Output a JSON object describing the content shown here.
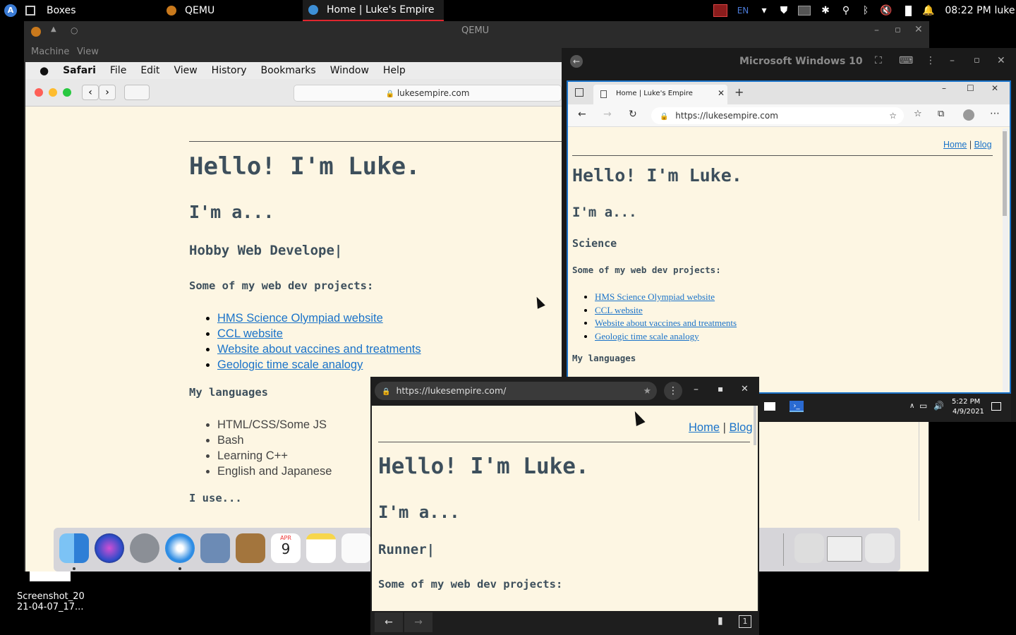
{
  "topbar": {
    "tasks": [
      {
        "label": "Boxes",
        "icon": "boxes-icon"
      },
      {
        "label": "QEMU",
        "icon": "qemu-icon"
      },
      {
        "label": "Home | Luke's Empire",
        "icon": "globe-icon"
      }
    ],
    "lang": "EN",
    "clock": "08:22 PM",
    "user": "luke"
  },
  "qemu": {
    "title": "QEMU",
    "menu": [
      "Machine",
      "View"
    ]
  },
  "mac": {
    "menubar": [
      "Safari",
      "File",
      "Edit",
      "View",
      "History",
      "Bookmarks",
      "Window",
      "Help"
    ],
    "url": "lukesempire.com",
    "page": {
      "h1": "Hello! I'm Luke.",
      "h2": "I'm a...",
      "typing": "Hobby Web Develope|",
      "projects_heading": "Some of my web dev projects:",
      "projects": [
        "HMS Science Olympiad website",
        "CCL website",
        "Website about vaccines and treatments",
        "Geologic time scale analogy"
      ],
      "languages_heading": "My languages",
      "languages": [
        "HTML/CSS/Some JS",
        "Bash",
        "Learning C++",
        "English and Japanese"
      ],
      "use_heading": "I use..."
    },
    "dock_calendar_month": "APR",
    "dock_calendar_day": "9"
  },
  "winvm": {
    "title": "Microsoft Windows 10",
    "tab_title": "Home | Luke's Empire",
    "url": "https://lukesempire.com",
    "nav_home": "Home",
    "nav_sep": "|",
    "nav_blog": "Blog",
    "h1": "Hello! I'm Luke.",
    "h2": "I'm a...",
    "typing": "Science",
    "projects_heading": "Some of my web dev projects:",
    "projects": [
      "HMS Science Olympiad website",
      "CCL website",
      "Website about vaccines and treatments",
      "Geologic time scale analogy"
    ],
    "languages_heading": "My languages",
    "taskbar_time": "5:22 PM",
    "taskbar_date": "4/9/2021"
  },
  "mini": {
    "url": "https://lukesempire.com/",
    "nav_home": "Home",
    "nav_sep": "|",
    "nav_blog": "Blog",
    "h1": "Hello! I'm Luke.",
    "h2": "I'm a...",
    "typing": "Runner|",
    "projects_heading": "Some of my web dev projects:",
    "tab_count": "1"
  },
  "desktop": {
    "file_label_1": "Screenshot_20",
    "file_label_2": "21-04-07_17..."
  }
}
